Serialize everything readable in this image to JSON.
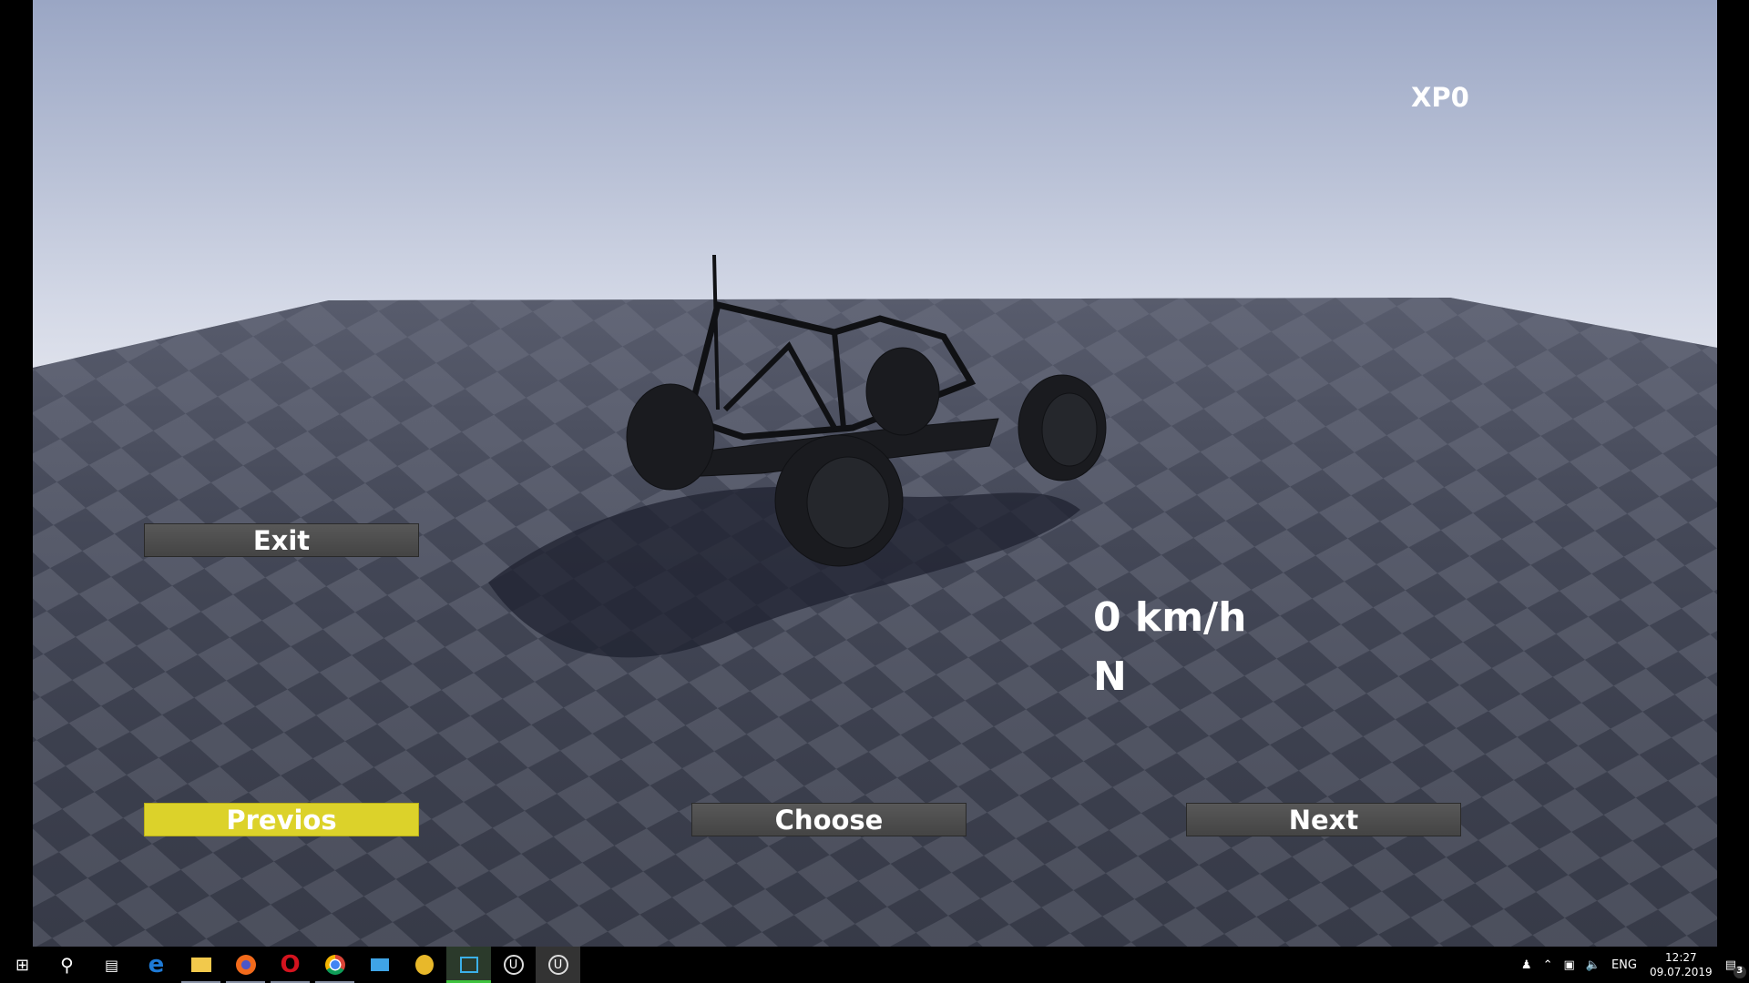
{
  "hud": {
    "xp": "XP0",
    "speed": "0 km/h",
    "gear": "N"
  },
  "buttons": {
    "exit": "Exit",
    "previous": "Previos",
    "choose": "Choose",
    "next": "Next"
  },
  "colors": {
    "selected_button": "#dcd22a",
    "button": "#4e4e4e",
    "floor_dark": "#3b3f4d",
    "floor_light": "#5a5e6c"
  },
  "taskbar": {
    "apps": [
      "start-icon",
      "search-icon",
      "task-view-icon",
      "edge-icon",
      "file-explorer-icon",
      "firefox-icon",
      "opera-icon",
      "chrome-icon",
      "laptop-app-icon",
      "fl-studio-icon",
      "video-editor-icon",
      "unreal-engine-icon",
      "unreal-engine-icon"
    ],
    "language": "ENG",
    "time": "12:27",
    "date": "09.07.2019",
    "notifications": "3"
  }
}
